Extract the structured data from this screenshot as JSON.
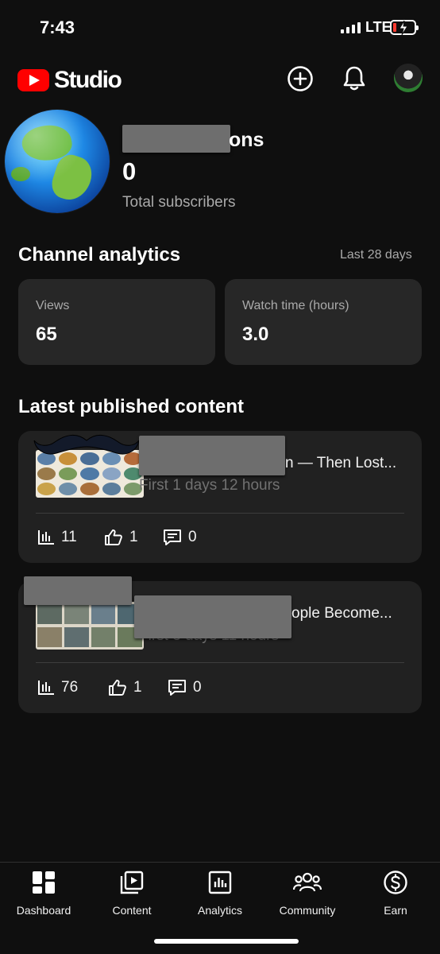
{
  "status_bar": {
    "time": "7:43",
    "network": "LTE",
    "battery_low_color": "#ff3b30"
  },
  "app_bar": {
    "title": "Studio",
    "icons": [
      "add-circle-icon",
      "bell-icon",
      "profile-avatar"
    ],
    "brand_color": "#ff0000"
  },
  "channel": {
    "name_visible": "ons",
    "subscribers": "0",
    "subscribers_label": "Total subscribers"
  },
  "analytics": {
    "title": "Channel analytics",
    "period": "Last 28 days",
    "cards": [
      {
        "label": "Views",
        "value": "65"
      },
      {
        "label": "Watch time (hours)",
        "value": "3.0"
      }
    ]
  },
  "latest": {
    "title": "Latest published content",
    "items": [
      {
        "title_visible": "n — Then Lost...",
        "subtitle": "First 1 days 12 hours",
        "views": "11",
        "likes": "1",
        "comments": "0"
      },
      {
        "title_visible": "ople Become...",
        "subtitle": "First 3 days 11 hours",
        "views": "76",
        "likes": "1",
        "comments": "0"
      }
    ]
  },
  "bottom_nav": {
    "items": [
      {
        "label": "Dashboard",
        "icon": "dashboard-icon"
      },
      {
        "label": "Content",
        "icon": "content-icon"
      },
      {
        "label": "Analytics",
        "icon": "analytics-icon"
      },
      {
        "label": "Community",
        "icon": "community-icon"
      },
      {
        "label": "Earn",
        "icon": "dollar-icon"
      }
    ]
  }
}
